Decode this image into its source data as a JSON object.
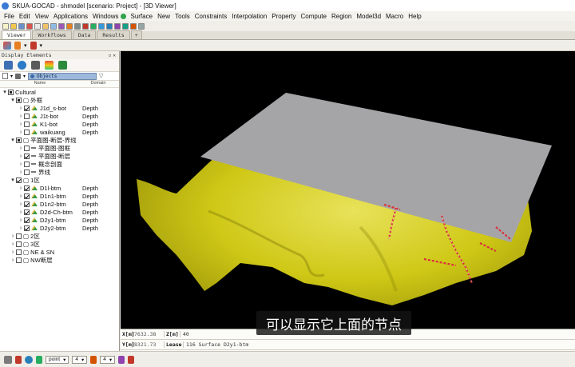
{
  "window": {
    "title": "SKUA-GOCAD - shmodel [scenario: Project] - [3D Viewer]"
  },
  "menu": [
    "File",
    "Edit",
    "View",
    "Applications",
    "Windows",
    "Surface",
    "New",
    "Tools",
    "Constraints",
    "Interpolation",
    "Property",
    "Compute",
    "Region",
    "Model3d",
    "Macro",
    "Help"
  ],
  "tabs": [
    "Viewer",
    "Workflows",
    "Data",
    "Results",
    "+"
  ],
  "panel": {
    "title": "Display Elements",
    "search": "Objects",
    "col_name": "Name",
    "col_domain": "Domain"
  },
  "tree": [
    {
      "level": 0,
      "arrow": "▾",
      "cb": "partial",
      "label": "Cultural",
      "domain": ""
    },
    {
      "level": 1,
      "arrow": "▾",
      "cb": "partial",
      "label": "▢ 外框",
      "domain": ""
    },
    {
      "level": 2,
      "arrow": "›",
      "cb": "checked",
      "label": "J1d_s-bot",
      "domain": "Depth"
    },
    {
      "level": 2,
      "arrow": "›",
      "cb": "",
      "label": "J1t-bot",
      "domain": "Depth"
    },
    {
      "level": 2,
      "arrow": "›",
      "cb": "",
      "label": "K1-bot",
      "domain": "Depth"
    },
    {
      "level": 2,
      "arrow": "›",
      "cb": "",
      "label": "waikuang",
      "domain": "Depth"
    },
    {
      "level": 1,
      "arrow": "▾",
      "cb": "partial",
      "label": "▢ 平面图-断层-界线",
      "domain": ""
    },
    {
      "level": 2,
      "arrow": "›",
      "cb": "",
      "label": "平面图-图框",
      "domain": ""
    },
    {
      "level": 2,
      "arrow": "›",
      "cb": "checked",
      "label": "平面图-断层",
      "domain": ""
    },
    {
      "level": 2,
      "arrow": "›",
      "cb": "",
      "label": "概念剖面",
      "domain": ""
    },
    {
      "level": 2,
      "arrow": "›",
      "cb": "",
      "label": "界线",
      "domain": ""
    },
    {
      "level": 1,
      "arrow": "▾",
      "cb": "checked",
      "label": "▢ 1区",
      "domain": ""
    },
    {
      "level": 2,
      "arrow": "›",
      "cb": "checked",
      "label": "D1l-btm",
      "domain": "Depth"
    },
    {
      "level": 2,
      "arrow": "›",
      "cb": "checked",
      "label": "D1n1-btm",
      "domain": "Depth"
    },
    {
      "level": 2,
      "arrow": "›",
      "cb": "checked",
      "label": "D1n2-btm",
      "domain": "Depth"
    },
    {
      "level": 2,
      "arrow": "›",
      "cb": "checked",
      "label": "D2d-Ch-btm",
      "domain": "Depth"
    },
    {
      "level": 2,
      "arrow": "›",
      "cb": "checked",
      "label": "D2y1-btm",
      "domain": "Depth"
    },
    {
      "level": 2,
      "arrow": "›",
      "cb": "checked",
      "label": "D2y2-btm",
      "domain": "Depth"
    },
    {
      "level": 1,
      "arrow": "›",
      "cb": "",
      "label": "▢ 2区",
      "domain": ""
    },
    {
      "level": 1,
      "arrow": "›",
      "cb": "",
      "label": "▢ 3区",
      "domain": ""
    },
    {
      "level": 1,
      "arrow": "›",
      "cb": "",
      "label": "▢ NE & SN",
      "domain": ""
    },
    {
      "level": 1,
      "arrow": "›",
      "cb": "",
      "label": "▢ NW断层",
      "domain": ""
    }
  ],
  "status": {
    "x_label": "X[m]",
    "x_value": "7632.38",
    "z_label": "Z[m]",
    "z_value": "40",
    "y_label": "Y[m]",
    "y_value": "8321.73",
    "lease_label": "Lease",
    "lease_value": "116 Surface D2y1-btm"
  },
  "subtitle": "可以显示它上面的节点",
  "bottom": {
    "mode": "point",
    "size": "4",
    "size2": "4"
  },
  "colors": {
    "surface": "#d8d21a",
    "plane": "#a2a2a4",
    "faults": "#d8323a"
  }
}
